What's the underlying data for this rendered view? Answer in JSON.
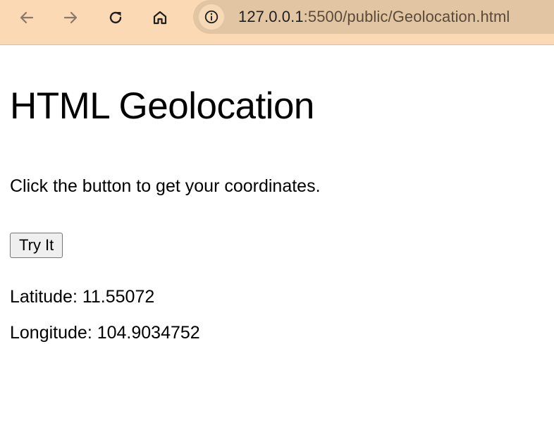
{
  "browser": {
    "url_host": "127.0.0.1",
    "url_path": ":5500/public/Geolocation.html",
    "icons": {
      "back": "arrow-left-icon",
      "forward": "arrow-right-icon",
      "reload": "reload-icon",
      "home": "home-icon",
      "site_info": "info-icon"
    },
    "colors": {
      "toolbar_bg": "#fbd9b4",
      "omnibox_bg": "#e2c5a3"
    }
  },
  "page": {
    "heading": "HTML Geolocation",
    "description": "Click the button to get your coordinates.",
    "button_label": "Try It",
    "latitude_text": "Latitude: 11.55072",
    "longitude_text": "Longitude: 104.9034752"
  }
}
